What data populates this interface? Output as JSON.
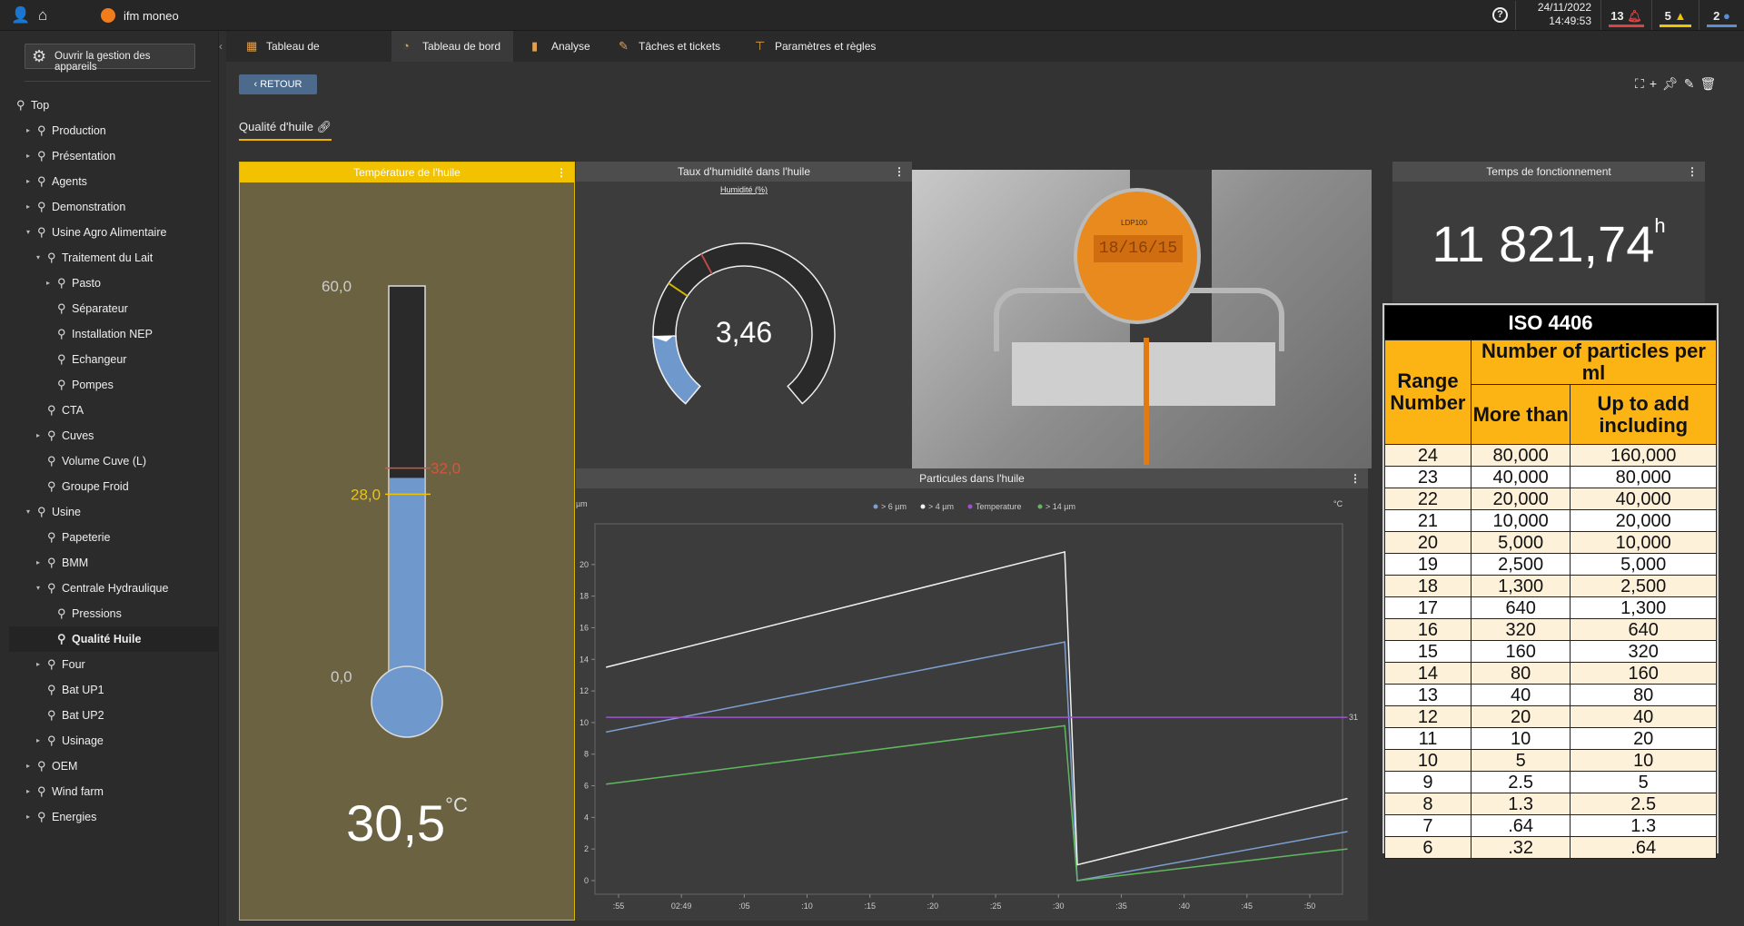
{
  "topbar": {
    "brand": "ifm moneo",
    "date": "24/11/2022",
    "time": "14:49:53",
    "alerts": [
      {
        "count": "13",
        "icon": "bell-icon",
        "color": "#e04040"
      },
      {
        "count": "5",
        "icon": "warning-icon",
        "color": "#f0c400"
      },
      {
        "count": "2",
        "icon": "info-icon",
        "color": "#5b8fd0"
      }
    ]
  },
  "sidebar": {
    "device_button": "Ouvrir la gestion des appareils",
    "items": [
      {
        "label": "Top",
        "level": 0,
        "arrow": ""
      },
      {
        "label": "Production",
        "level": 1,
        "arrow": "▸"
      },
      {
        "label": "Présentation",
        "level": 1,
        "arrow": "▸"
      },
      {
        "label": "Agents",
        "level": 1,
        "arrow": "▸"
      },
      {
        "label": "Demonstration",
        "level": 1,
        "arrow": "▸"
      },
      {
        "label": "Usine Agro Alimentaire",
        "level": 1,
        "arrow": "▾"
      },
      {
        "label": "Traitement du Lait",
        "level": 2,
        "arrow": "▾"
      },
      {
        "label": "Pasto",
        "level": 3,
        "arrow": "▸"
      },
      {
        "label": "Séparateur",
        "level": 3,
        "arrow": ""
      },
      {
        "label": "Installation NEP",
        "level": 3,
        "arrow": ""
      },
      {
        "label": "Echangeur",
        "level": 3,
        "arrow": ""
      },
      {
        "label": "Pompes",
        "level": 3,
        "arrow": ""
      },
      {
        "label": "CTA",
        "level": 2,
        "arrow": ""
      },
      {
        "label": "Cuves",
        "level": 2,
        "arrow": "▸"
      },
      {
        "label": "Volume Cuve (L)",
        "level": 2,
        "arrow": ""
      },
      {
        "label": "Groupe Froid",
        "level": 2,
        "arrow": ""
      },
      {
        "label": "Usine",
        "level": 1,
        "arrow": "▾"
      },
      {
        "label": "Papeterie",
        "level": 2,
        "arrow": ""
      },
      {
        "label": "BMM",
        "level": 2,
        "arrow": "▸"
      },
      {
        "label": "Centrale Hydraulique",
        "level": 2,
        "arrow": "▾"
      },
      {
        "label": "Pressions",
        "level": 3,
        "arrow": ""
      },
      {
        "label": "Qualité Huile",
        "level": 3,
        "arrow": "",
        "selected": true
      },
      {
        "label": "Four",
        "level": 2,
        "arrow": "▸"
      },
      {
        "label": "Bat UP1",
        "level": 2,
        "arrow": ""
      },
      {
        "label": "Bat UP2",
        "level": 2,
        "arrow": ""
      },
      {
        "label": "Usinage",
        "level": 2,
        "arrow": "▸"
      },
      {
        "label": "OEM",
        "level": 1,
        "arrow": "▸"
      },
      {
        "label": "Wind farm",
        "level": 1,
        "arrow": "▸"
      },
      {
        "label": "Energies",
        "level": 1,
        "arrow": "▸"
      }
    ]
  },
  "tabs": [
    {
      "label": "Tableau de surveillance",
      "icon": "grid-icon"
    },
    {
      "label": "Tableau de bord",
      "icon": "dashboard-icon",
      "active": true
    },
    {
      "label": "Analyse",
      "icon": "analysis-icon"
    },
    {
      "label": "Tâches et tickets",
      "icon": "tasks-icon"
    },
    {
      "label": "Paramètres et règles",
      "icon": "rules-icon"
    }
  ],
  "main": {
    "back_label": "RETOUR",
    "page_title": "Qualité d'huile"
  },
  "temperature": {
    "title": "Température de l'huile",
    "value": "30,5",
    "unit": "°C",
    "value_num": 30.5,
    "max_label": "60,0",
    "min_label": "0,0",
    "min": 0,
    "max": 60,
    "warning_label": "28,0",
    "warning": 28,
    "alarm_label": "32,0",
    "alarm": 32,
    "fill_color": "#6f98cc",
    "warning_color": "#f0c400",
    "alarm_color": "#d9533d"
  },
  "humidity": {
    "title": "Taux d'humidité dans l'huile",
    "subtitle": "Humidité (%)",
    "value": "3,46",
    "value_num": 3.46,
    "min": 0,
    "max": 20,
    "warning": 6,
    "alarm": 8,
    "fill_color": "#6f98cc"
  },
  "runtime": {
    "title": "Temps de fonctionnement",
    "value": "11 821,74",
    "unit": "h"
  },
  "particles": {
    "title": "Particules dans l'huile"
  },
  "chart_data": {
    "type": "line",
    "left_unit": "µm",
    "right_unit": "°C",
    "ylim": [
      0,
      22
    ],
    "y2lim": [
      0,
      66
    ],
    "yticks": [
      "0",
      "2",
      "4",
      "6",
      "8",
      "10",
      "12",
      "14",
      "16",
      "18",
      "20"
    ],
    "y2ticks": [
      "31"
    ],
    "xticks": [
      ":55",
      "02:49",
      ":05",
      ":10",
      ":15",
      ":20",
      ":25",
      ":30",
      ":35",
      ":40",
      ":45",
      ":50"
    ],
    "x": [
      "02:48:54",
      "02:49:30.5",
      "02:49:31.5",
      "02:49:53"
    ],
    "series": [
      {
        "name": "> 6 µm",
        "color": "#7d9fd0",
        "axis": "left",
        "values": [
          9.4,
          15.1,
          0,
          3.1
        ]
      },
      {
        "name": "> 4 µm",
        "color": "#f2f2f2",
        "axis": "left",
        "values": [
          13.5,
          20.8,
          1.0,
          5.2
        ]
      },
      {
        "name": "Temperature",
        "color": "#a050d0",
        "axis": "right",
        "values": [
          31,
          31,
          31,
          31
        ]
      },
      {
        "name": "> 14 µm",
        "color": "#5fb85f",
        "axis": "left",
        "values": [
          6.1,
          9.8,
          0,
          2.0
        ]
      }
    ]
  },
  "iso": {
    "title": "ISO 4406",
    "group_header": "Number of particles per ml",
    "col_range": "Range Number",
    "col_more": "More than",
    "col_upto": "Up to add including",
    "rows": [
      [
        "24",
        "80,000",
        "160,000"
      ],
      [
        "23",
        "40,000",
        "80,000"
      ],
      [
        "22",
        "20,000",
        "40,000"
      ],
      [
        "21",
        "10,000",
        "20,000"
      ],
      [
        "20",
        "5,000",
        "10,000"
      ],
      [
        "19",
        "2,500",
        "5,000"
      ],
      [
        "18",
        "1,300",
        "2,500"
      ],
      [
        "17",
        "640",
        "1,300"
      ],
      [
        "16",
        "320",
        "640"
      ],
      [
        "15",
        "160",
        "320"
      ],
      [
        "14",
        "80",
        "160"
      ],
      [
        "13",
        "40",
        "80"
      ],
      [
        "12",
        "20",
        "40"
      ],
      [
        "11",
        "10",
        "20"
      ],
      [
        "10",
        "5",
        "10"
      ],
      [
        "9",
        "2.5",
        "5"
      ],
      [
        "8",
        "1.3",
        "2.5"
      ],
      [
        "7",
        ".64",
        "1.3"
      ],
      [
        "6",
        ".32",
        ".64"
      ]
    ]
  },
  "photo": {
    "display_text": "18/16/15",
    "device_label": "LDP100"
  }
}
